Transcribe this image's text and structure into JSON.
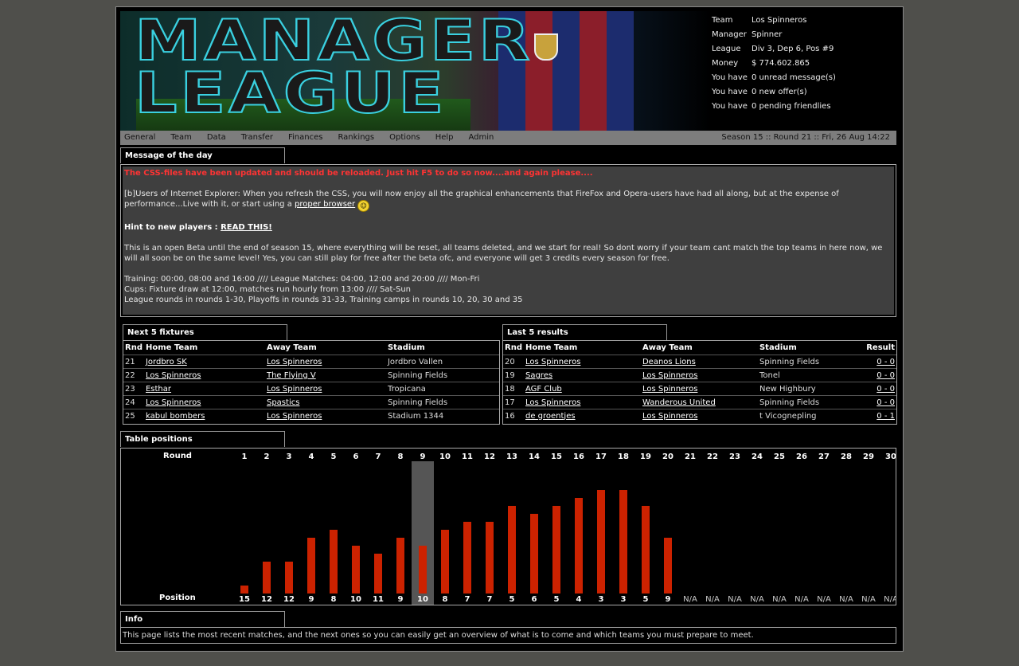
{
  "banner": {
    "logo_line1": "MANAGER",
    "logo_line2": "LEAGUE"
  },
  "team_info": [
    {
      "k": "Team",
      "v": "Los Spinneros"
    },
    {
      "k": "Manager",
      "v": "Spinner"
    },
    {
      "k": "League",
      "v": "Div 3, Dep 6, Pos #9"
    },
    {
      "k": "Money",
      "v": "$ 774.602.865"
    },
    {
      "k": "You have",
      "v": "0 unread message(s)"
    },
    {
      "k": "You have",
      "v": "0 new offer(s)"
    },
    {
      "k": "You have",
      "v": "0 pending friendlies"
    }
  ],
  "menu": [
    "General",
    "Team",
    "Data",
    "Transfer",
    "Finances",
    "Rankings",
    "Options",
    "Help",
    "Admin"
  ],
  "season_status": "Season 15 :: Round 21 :: Fri, 26 Aug 14:22",
  "motd": {
    "title": "Message of the day",
    "red": "The CSS-files have been updated and should be reloaded. Just hit F5 to do so now....and again please....",
    "ie_text": "[b]Users of Internet Explorer: When you refresh the CSS, you will now enjoy all the graphical enhancements that FireFox and Opera-users have had all along, but at the expense of performance...Live with it, or start using a ",
    "ie_link": "proper browser",
    "hint_label": "Hint to new players : ",
    "hint_link": "READ THIS!",
    "beta": "This is an open Beta until the end of season 15, where everything will be reset, all teams deleted, and we start for real! So dont worry if your team cant match the top teams in here now, we will all soon be on the same level! Yes, you can still play for free after the beta ofc, and everyone will get 3 credits every season for free.",
    "line1": "Training: 00:00, 08:00 and 16:00 //// League Matches: 04:00, 12:00 and 20:00 //// Mon-Fri",
    "line2": "Cups: Fixture draw at 12:00, matches run hourly from 13:00 //// Sat-Sun",
    "line3": "League rounds in rounds 1-30, Playoffs in rounds 31-33, Training camps in rounds 10, 20, 30 and 35"
  },
  "fixtures": {
    "title": "Next 5 fixtures",
    "headers": [
      "Rnd",
      "Home Team",
      "Away Team",
      "Stadium"
    ],
    "rows": [
      [
        "21",
        "Jordbro SK",
        "Los Spinneros",
        "Jordbro Vallen"
      ],
      [
        "22",
        "Los Spinneros",
        "The Flying V",
        "Spinning Fields"
      ],
      [
        "23",
        "Esthar",
        "Los Spinneros",
        "Tropicana"
      ],
      [
        "24",
        "Los Spinneros",
        "Spastics",
        "Spinning Fields"
      ],
      [
        "25",
        "kabul bombers",
        "Los Spinneros",
        "Stadium 1344"
      ]
    ]
  },
  "results": {
    "title": "Last 5 results",
    "headers": [
      "Rnd",
      "Home Team",
      "Away Team",
      "Stadium",
      "Result"
    ],
    "rows": [
      [
        "20",
        "Los Spinneros",
        "Deanos Lions",
        "Spinning Fields",
        "0 - 0"
      ],
      [
        "19",
        "Sagres",
        "Los Spinneros",
        "Tonel",
        "0 - 0"
      ],
      [
        "18",
        "AGF Club",
        "Los Spinneros",
        "New Highbury",
        "0 - 0"
      ],
      [
        "17",
        "Los Spinneros",
        "Wanderous United",
        "Spinning Fields",
        "0 - 0"
      ],
      [
        "16",
        "de groentjes",
        "Los Spinneros",
        "t Vicognepling",
        "0 - 1"
      ]
    ]
  },
  "table_positions": {
    "title": "Table positions",
    "round_label": "Round",
    "position_label": "Position"
  },
  "chart_data": {
    "type": "bar",
    "categories": [
      "1",
      "2",
      "3",
      "4",
      "5",
      "6",
      "7",
      "8",
      "9",
      "10",
      "11",
      "12",
      "13",
      "14",
      "15",
      "16",
      "17",
      "18",
      "19",
      "20",
      "21",
      "22",
      "23",
      "24",
      "25",
      "26",
      "27",
      "28",
      "29",
      "30"
    ],
    "values": [
      15,
      12,
      12,
      9,
      8,
      10,
      11,
      9,
      10,
      8,
      7,
      7,
      5,
      6,
      5,
      4,
      3,
      3,
      5,
      9,
      null,
      null,
      null,
      null,
      null,
      null,
      null,
      null,
      null,
      null
    ],
    "value_labels": [
      "15",
      "12",
      "12",
      "9",
      "8",
      "10",
      "11",
      "9",
      "10",
      "8",
      "7",
      "7",
      "5",
      "6",
      "5",
      "4",
      "3",
      "3",
      "5",
      "9",
      "N/A",
      "N/A",
      "N/A",
      "N/A",
      "N/A",
      "N/A",
      "N/A",
      "N/A",
      "N/A",
      "N/A"
    ],
    "highlight_round": "9",
    "bar_color": "#cc2200",
    "highlight_color": "#555555"
  },
  "info": {
    "title": "Info",
    "text": "This page lists the most recent matches, and the next ones so you can easily get an overview of what is to come and which teams you must prepare to meet."
  }
}
